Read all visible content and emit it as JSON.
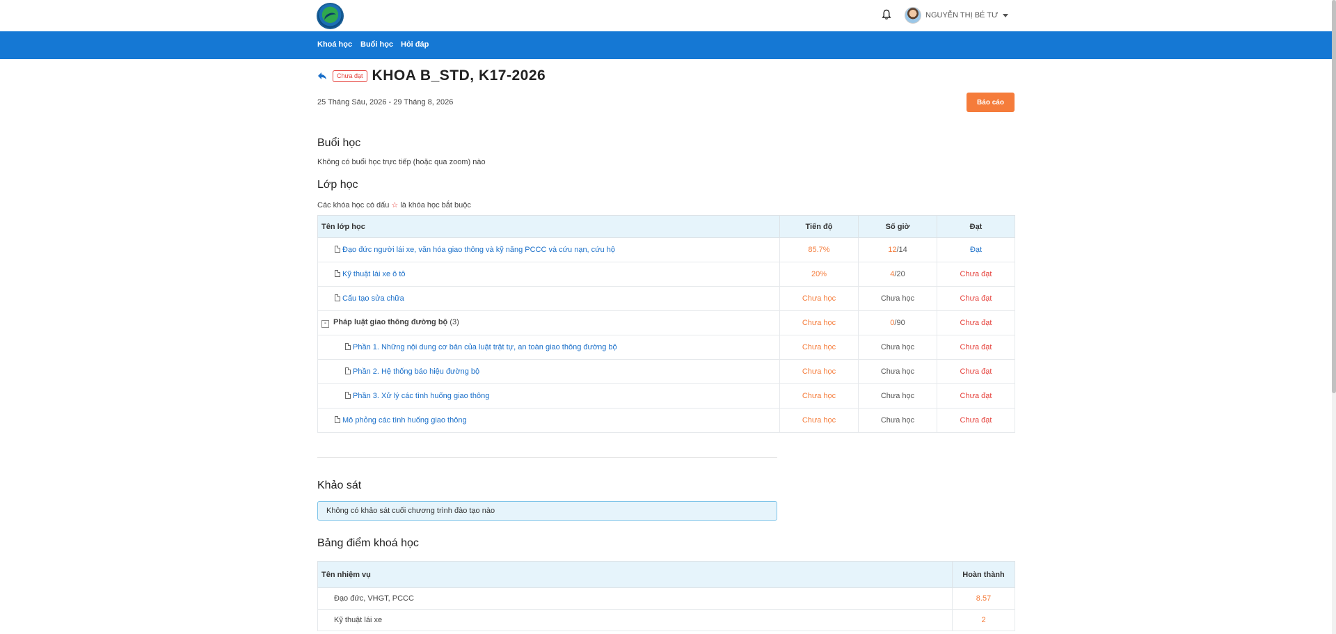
{
  "header": {
    "user_name": "NGUYỄN THỊ BÉ TƯ"
  },
  "nav": {
    "items": [
      "Khoá học",
      "Buổi học",
      "Hỏi đáp"
    ]
  },
  "course": {
    "status_badge": "Chưa đạt",
    "title": "KHOA B_STD, K17-2026",
    "date_range": "25 Tháng Sáu, 2026 - 29 Tháng 8, 2026",
    "report_button": "Báo cáo"
  },
  "sessions": {
    "heading": "Buổi học",
    "empty_text": "Không có buổi học trực tiếp (hoặc qua zoom) nào"
  },
  "classes": {
    "heading": "Lớp học",
    "note_before": "Các khóa học có dấu",
    "note_star": "☆",
    "note_after": "là khóa học bắt buộc",
    "columns": [
      "Tên lớp học",
      "Tiến độ",
      "Số giờ",
      "Đạt"
    ],
    "rows": [
      {
        "name": "Đạo đức người lái xe, văn hóa giao thông và kỹ năng PCCC và cứu nạn, cứu hộ",
        "progress": "85.7%",
        "hours_done": "12",
        "hours_total": "/14",
        "status": "Đạt"
      },
      {
        "name": "Kỹ thuật lái xe ô tô",
        "progress": "20%",
        "hours_done": "4",
        "hours_total": "/20",
        "status": "Chưa đạt"
      },
      {
        "name": "Cấu tạo sửa chữa",
        "progress": "Chưa học",
        "hours": "Chưa học",
        "status": "Chưa đạt"
      },
      {
        "name": "Pháp luật giao thông đường bộ",
        "count": "(3)",
        "toggle": "-",
        "progress": "Chưa học",
        "hours_done": "0",
        "hours_total": "/90",
        "status": "Chưa đạt"
      },
      {
        "name": "Phần 1. Những nội dung cơ bản của luật trật tự, an toàn giao thông đường bộ",
        "progress": "Chưa học",
        "hours": "Chưa học",
        "status": "Chưa đạt"
      },
      {
        "name": "Phần 2. Hệ thống báo hiệu đường bộ",
        "progress": "Chưa học",
        "hours": "Chưa học",
        "status": "Chưa đạt"
      },
      {
        "name": "Phần 3. Xử lý các tình huống giao thông",
        "progress": "Chưa học",
        "hours": "Chưa học",
        "status": "Chưa đạt"
      },
      {
        "name": "Mô phỏng các tình huống giao thông",
        "progress": "Chưa học",
        "hours": "Chưa học",
        "status": "Chưa đạt"
      }
    ]
  },
  "survey": {
    "heading": "Khảo sát",
    "empty_text": "Không có khảo sát cuối chương trình đào tạo nào"
  },
  "scores": {
    "heading": "Bảng điểm khoá học",
    "columns": [
      "Tên nhiệm vụ",
      "Hoàn thành"
    ],
    "rows": [
      {
        "task": "Đạo đức, VHGT, PCCC",
        "score": "8.57"
      },
      {
        "task": "Kỹ thuật lái xe",
        "score": "2"
      }
    ]
  },
  "colors": {
    "primary": "#1578d4",
    "accent": "#f57c3b",
    "danger": "#e5403a",
    "table_header": "#e6f4fb"
  }
}
